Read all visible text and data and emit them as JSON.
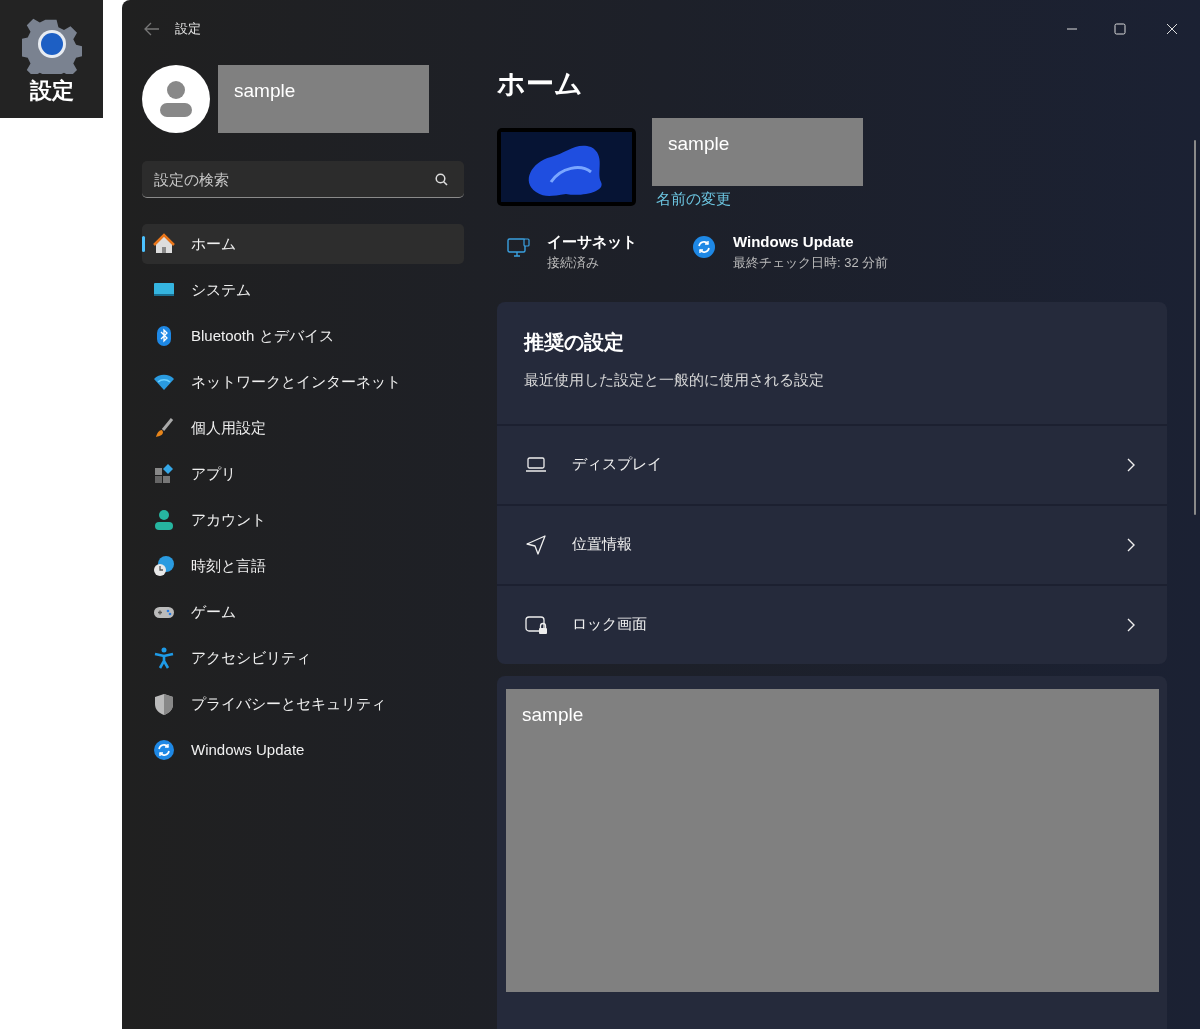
{
  "taskbar_tile": {
    "label": "設定"
  },
  "window": {
    "title": "設定"
  },
  "account": {
    "name": "sample"
  },
  "search": {
    "placeholder": "設定の検索"
  },
  "sidebar": {
    "items": [
      {
        "label": "ホーム",
        "selected": true
      },
      {
        "label": "システム",
        "selected": false
      },
      {
        "label": "Bluetooth とデバイス",
        "selected": false
      },
      {
        "label": "ネットワークとインターネット",
        "selected": false
      },
      {
        "label": "個人用設定",
        "selected": false
      },
      {
        "label": "アプリ",
        "selected": false
      },
      {
        "label": "アカウント",
        "selected": false
      },
      {
        "label": "時刻と言語",
        "selected": false
      },
      {
        "label": "ゲーム",
        "selected": false
      },
      {
        "label": "アクセシビリティ",
        "selected": false
      },
      {
        "label": "プライバシーとセキュリティ",
        "selected": false
      },
      {
        "label": "Windows Update",
        "selected": false
      }
    ]
  },
  "page": {
    "title": "ホーム"
  },
  "device": {
    "name": "sample",
    "rename_link": "名前の変更"
  },
  "status": [
    {
      "title": "イーサネット",
      "subtitle": "接続済み"
    },
    {
      "title": "Windows Update",
      "subtitle": "最終チェック日時: 32 分前"
    }
  ],
  "recommended": {
    "title": "推奨の設定",
    "subtitle": "最近使用した設定と一般的に使用される設定",
    "items": [
      {
        "label": "ディスプレイ"
      },
      {
        "label": "位置情報"
      },
      {
        "label": "ロック画面"
      }
    ]
  },
  "promo": {
    "text": "sample"
  }
}
